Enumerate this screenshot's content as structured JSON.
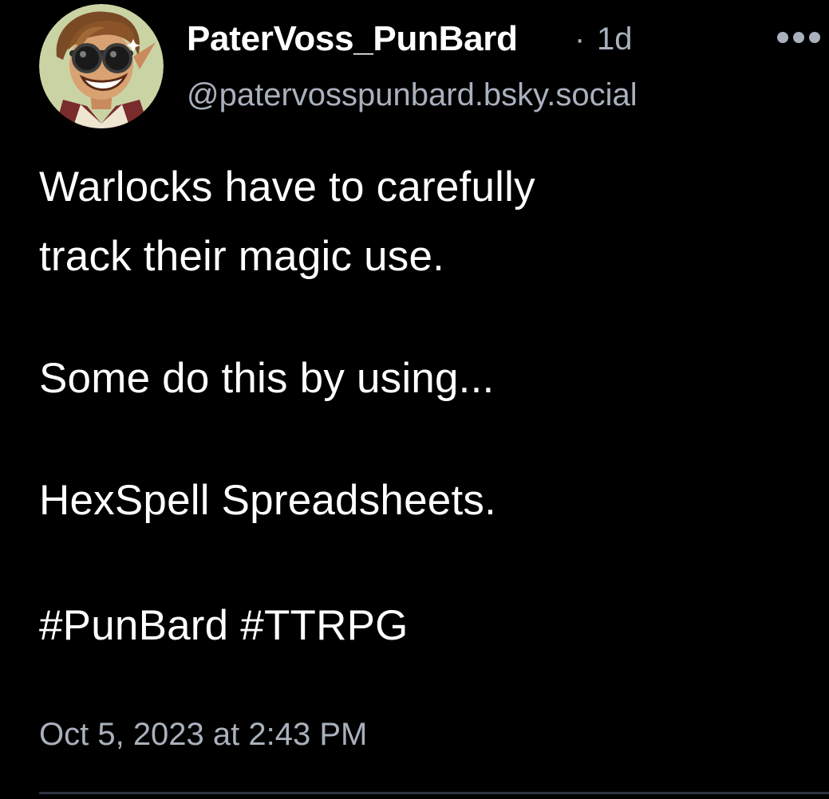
{
  "post": {
    "author": {
      "display_name": "PaterVoss_PunBard",
      "handle": "@patervosspunbard.bsky.social",
      "avatar_icon": "avatar-illustration"
    },
    "separator": "·",
    "age": "1d",
    "more_icon": "ellipsis-icon",
    "text_lines": [
      "Warlocks have to carefully",
      "track their magic use.",
      "Some do this by using...",
      "HexSpell Spreadsheets."
    ],
    "hashtags": [
      "#PunBard",
      "#TTRPG"
    ],
    "timestamp": "Oct 5, 2023 at 2:43 PM"
  },
  "colors": {
    "background": "#000000",
    "text_primary": "#ffffff",
    "text_secondary": "#a9b1bd",
    "divider": "#2e3440",
    "avatar_bg": "#c9d3a4"
  }
}
